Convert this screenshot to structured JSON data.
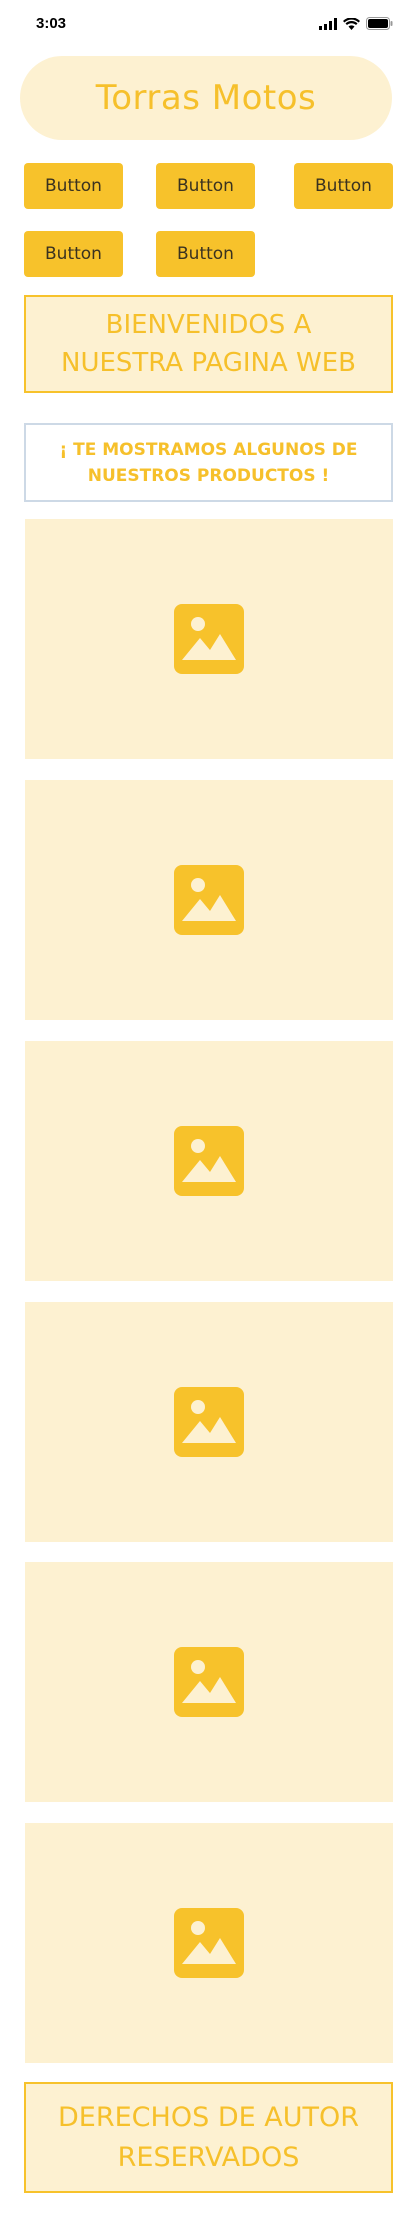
{
  "status_bar": {
    "time": "3:03",
    "icons": [
      "signal-icon",
      "wifi-icon",
      "battery-icon"
    ]
  },
  "header": {
    "title": "Torras Motos"
  },
  "buttons": [
    {
      "label": "Button"
    },
    {
      "label": "Button"
    },
    {
      "label": "Button"
    },
    {
      "label": "Button"
    },
    {
      "label": "Button"
    }
  ],
  "welcome": {
    "line1": "BIENVENIDOS A",
    "line2": "NUESTRA PAGINA WEB"
  },
  "notice": {
    "line1": "¡ TE MOSTRAMOS ALGUNOS DE",
    "line2": "NUESTROS PRODUCTOS !"
  },
  "products": [
    {
      "icon": "image-placeholder-icon"
    },
    {
      "icon": "image-placeholder-icon"
    },
    {
      "icon": "image-placeholder-icon"
    },
    {
      "icon": "image-placeholder-icon"
    },
    {
      "icon": "image-placeholder-icon"
    },
    {
      "icon": "image-placeholder-icon"
    }
  ],
  "footer": {
    "line1": "DERECHOS DE AUTOR",
    "line2": "RESERVADOS"
  },
  "colors": {
    "accent": "#f7c22b",
    "light_fill": "#fdf1d1",
    "notice_border": "#cdd9e6"
  }
}
